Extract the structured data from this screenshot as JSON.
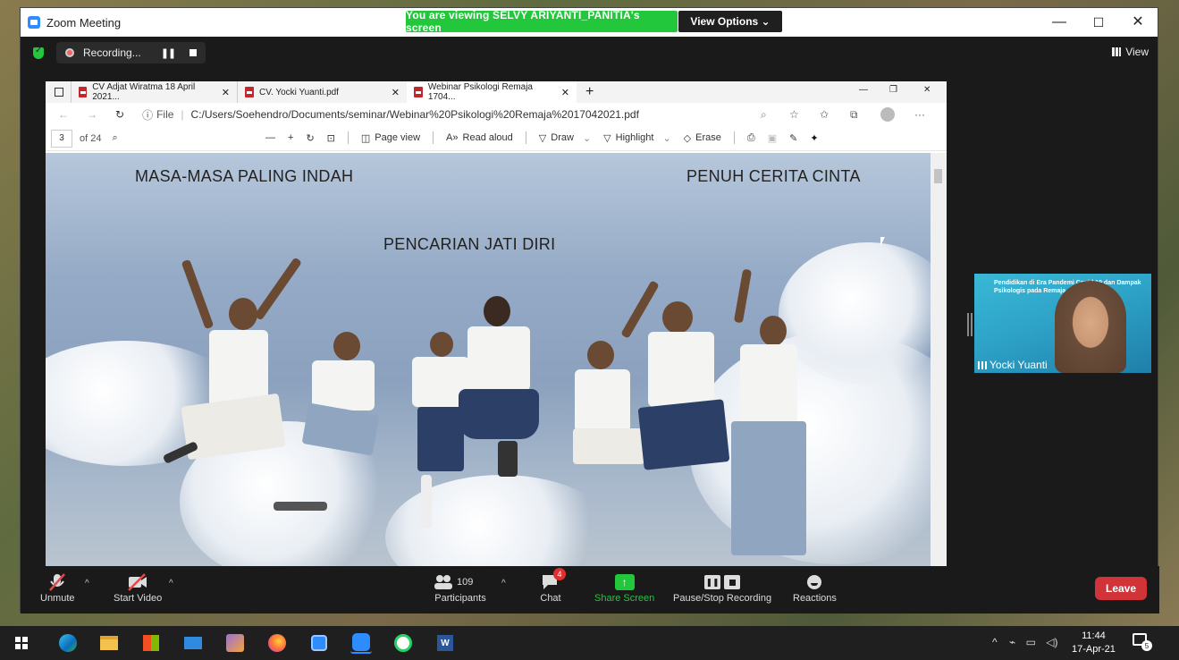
{
  "zoom": {
    "window_title": "Zoom Meeting",
    "viewing_banner": "You are viewing SELVY ARIYANTI_PANITIA's screen",
    "view_options": "View Options ⌄",
    "recording_label": "Recording...",
    "view_label": "View"
  },
  "edge": {
    "tabs": [
      {
        "label": "CV Adjat Wiratma 18 April 2021..."
      },
      {
        "label": "CV. Yocki Yuanti.pdf"
      },
      {
        "label": "Webinar Psikologi Remaja 1704..."
      }
    ],
    "address_prefix": "File",
    "address": "C:/Users/Soehendro/Documents/seminar/Webinar%20Psikologi%20Remaja%2017042021.pdf",
    "page_current": "3",
    "page_total": "of 24",
    "toolbar": {
      "page_view": "Page view",
      "read_aloud": "Read aloud",
      "draw": "Draw",
      "highlight": "Highlight",
      "erase": "Erase"
    }
  },
  "slide": {
    "text_left": "MASA-MASA PALING INDAH",
    "text_right": "PENUH CERITA CINTA",
    "text_center": "PENCARIAN JATI DIRI"
  },
  "participant": {
    "name": "Yocki Yuanti",
    "bg_text": "Pendidikan di Era Pandemi Covid 19 dan Dampak Psikologis pada Remaja"
  },
  "toolbar": {
    "unmute": "Unmute",
    "start_video": "Start Video",
    "participants": "Participants",
    "participants_count": "109",
    "chat": "Chat",
    "chat_badge": "4",
    "share_screen": "Share Screen",
    "pause_stop": "Pause/Stop Recording",
    "reactions": "Reactions",
    "leave": "Leave"
  },
  "taskbar": {
    "time": "11:44",
    "date": "17-Apr-21",
    "notification_count": "5"
  },
  "colors": {
    "zoom_green": "#23c73c",
    "leave_red": "#d13438",
    "zoom_blue": "#2d8cff"
  }
}
